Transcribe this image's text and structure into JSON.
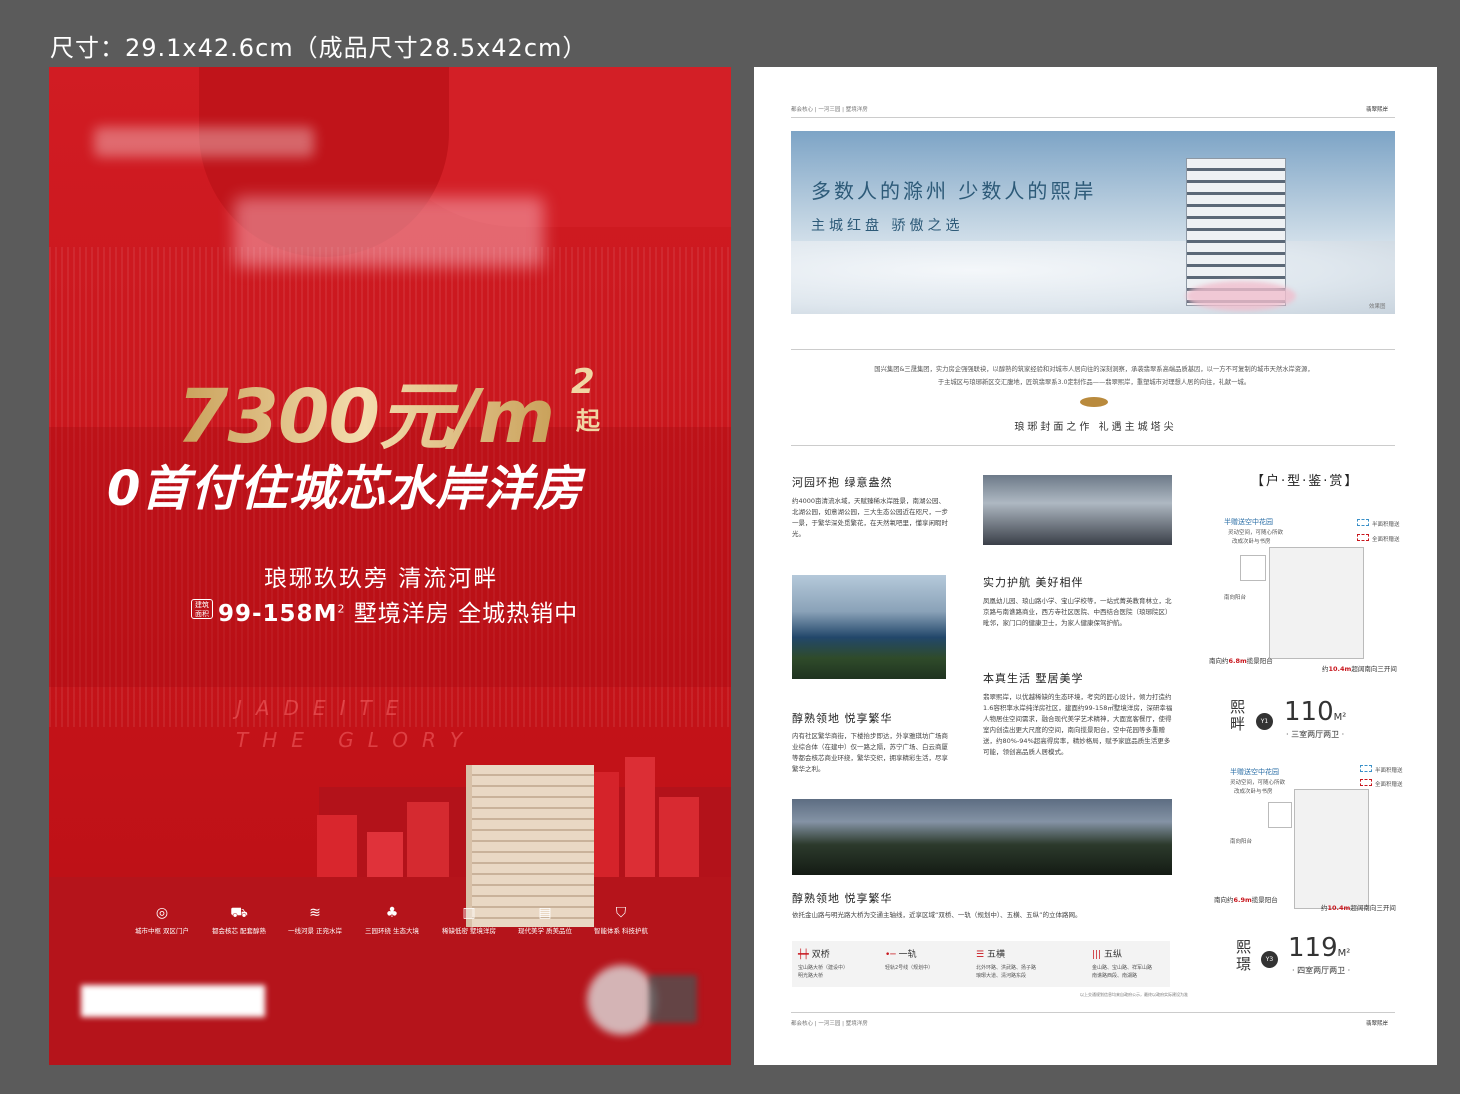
{
  "size_label": "尺寸：29.1x42.6cm（成品尺寸28.5x42cm）",
  "colors": {
    "poster_red": "#c8151c",
    "gold": "#e6c58a",
    "flyer_blue": "#2d5a78"
  },
  "poster": {
    "price": "7300元/m",
    "price_sup": "2",
    "price_suffix": "起",
    "headline": "0首付住城芯水岸洋房",
    "tagline1": "琅琊玖玖旁  清流河畔",
    "area_badge": "建筑面积",
    "area_range": "99-158M",
    "area_sup": "2",
    "tagline2_rest": " 墅境洋房  全城热销中",
    "jade_line1": "JADEITE",
    "jade_line2": "THE GLORY",
    "features": [
      {
        "icon": "◎",
        "icon_name": "location-icon",
        "text": "城市中枢 双区门户"
      },
      {
        "icon": "⛟",
        "icon_name": "cart-icon",
        "text": "都会核芯 配套醇熟"
      },
      {
        "icon": "≋",
        "icon_name": "water-icon",
        "text": "一线河景 正宛水岸"
      },
      {
        "icon": "♣",
        "icon_name": "tree-icon",
        "text": "三园环绕 生态大境"
      },
      {
        "icon": "▥",
        "icon_name": "building-icon",
        "text": "稀缺低密 墅境洋房"
      },
      {
        "icon": "▤",
        "icon_name": "facade-icon",
        "text": "现代美学 质美品位"
      },
      {
        "icon": "⛉",
        "icon_name": "shield-icon",
        "text": "智能体系 科技护航"
      }
    ]
  },
  "flyer": {
    "header_left": "都会核心 | 一河三园 | 墅境洋房",
    "header_right": "翡翠熙岸",
    "banner_slogan1": "多数人的滁州  少数人的熙岸",
    "banner_slogan2": "主城红盘  骄傲之选",
    "banner_note": "效果图",
    "intro_line1": "国兴集团&三晟集团，实力房企强强联袂，以醇熟的筑家经验和对城市人居向往的深刻洞察，承袭翡翠系高端品质基因，以一方不可复制的城市天然水岸资源，",
    "intro_line2": "于主城区与琅琊新区交汇腹地，匠筑翡翠系3.0定制作品——翡翠熙岸，重塑城市对理想人居的向往，礼献一城。",
    "intro_slogan": "琅琊封面之作  礼遇主城塔尖",
    "sections": [
      {
        "title": "河园环抱  绿意盎然",
        "text": "约4000亩清流水域，天赋臻稀水岸胜景，南湖公园、北湖公园，如意湖公园，三大生态公园近在咫尺，一步一景，于繁华深处觅繁花，在天然氧吧里，懂享闲暇时光。"
      },
      {
        "title": "实力护航  美好相伴",
        "text": "凤凰幼儿园、琅山路小学、宝山学校等，一站式菁英教育林立，北京路与南谯路商业，西方寺社区医院、中西结合医院（琅琊院区）毗邻，家门口的健康卫士，为家人健康保驾护航。"
      },
      {
        "title": "本真生活  墅居美学",
        "text": "翡翠熙岸，以优越稀缺的生态环境，考究的匠心设计，倾力打造约1.6容积率水岸纯洋房社区，建面约99-158㎡墅境洋房，深研幸福人物居住空间需求，融合现代美学艺术精神，大面宽客餐厅，使得室内创造出更大尺度的空间，南向揽景阳台，空中花园等多重赠送，约80%-94%超高得房率，精妙格局，赋予家庭品质生活更多可能，领创高品质人居模式。"
      },
      {
        "title": "醇熟领地  悦享繁华",
        "text": "内有社区繁华商街，下楼抬步即达，外享雅琪坊广场商业综合体（在建中）仅一路之隔，苏宁广场、白云商厦等都会核芯商业环绕，繁华交织，拥享精彩生活，尽享繁华之利。"
      },
      {
        "title": "醇熟领地  悦享繁华",
        "text": "依托金山路与明光路大桥为交通主轴线，近享区域“双桥、一轨（规划中）、五横、五纵”的立体路网。"
      }
    ],
    "traffic": [
      {
        "icon": "┿┿",
        "label": "双桥",
        "note": "宝山路大桥（建设中）\n明光路大桥"
      },
      {
        "icon": "•─",
        "label": "一轨",
        "note": "轻轨2号线（规划中）"
      },
      {
        "icon": "☰",
        "label": "五横",
        "note": "北外环路、洪武路、扬子路\n琅琊大道、清河路东段"
      },
      {
        "icon": "|||",
        "label": "五纵",
        "note": "金山路、宝山路、祥军山路\n南谯路西段、南湖路"
      }
    ],
    "traffic_disclaimer": "以上交通规划信息均来自政府公示，最终以政府实际建设为准",
    "unit_title": "【户·型·鉴·赏】",
    "plan_tag": "半赠送空中花园",
    "plan_tag_sub1": "灵动空间，可随心所欲",
    "plan_tag_sub2": "改成次卧与书房",
    "plan_legend1": "半面积赠送",
    "plan_legend2": "全面积赠送",
    "plan_note2": "南向阳台",
    "units": [
      {
        "name": "熙\n畔",
        "code": "Y1",
        "area": "110",
        "unit": "M²",
        "desc": "· 三室两厅两卫 ·",
        "dim1_pre": "南向约",
        "dim1": "6.8m",
        "dim1_post": "揽景阳台",
        "dim2_pre": "约",
        "dim2": "10.4m",
        "dim2_post": "超阔南向三开间"
      },
      {
        "name": "熙\n璟",
        "code": "Y3",
        "area": "119",
        "unit": "M²",
        "desc": "· 四室两厅两卫 ·",
        "dim1_pre": "南向约",
        "dim1": "6.9m",
        "dim1_post": "揽景阳台",
        "dim2_pre": "约",
        "dim2": "10.4m",
        "dim2_post": "超阔南向三开间"
      }
    ],
    "footer_left": "都会核心 | 一河三园 | 墅境洋房",
    "footer_right": "翡翠熙岸"
  }
}
